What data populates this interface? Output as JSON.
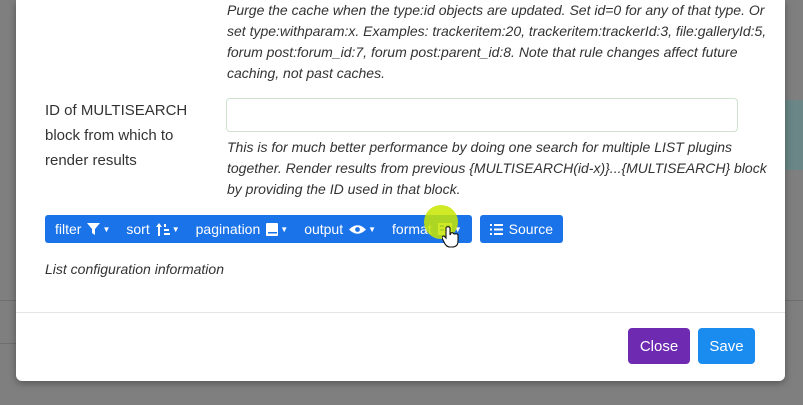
{
  "help_top": "Purge the cache when the type:id objects are updated. Set id=0 for any of that type. Or set type:withparam:x. Examples: trackeritem:20, trackeritem:trackerId:3, file:galleryId:5, forum post:forum_id:7, forum post:parent_id:8. Note that rule changes affect future caching, not past caches.",
  "field": {
    "label": "ID of MULTISEARCH block from which to render results",
    "value": "",
    "placeholder": ""
  },
  "help_bottom": "This is for much better performance by doing one search for multiple LIST plugins together. Render results from previous {MULTISEARCH(id-x)}...{MULTISEARCH} block by providing the ID used in that block.",
  "toolbar": {
    "filter": "filter",
    "sort": "sort",
    "pagination": "pagination",
    "output": "output",
    "format": "format",
    "source": "Source"
  },
  "config_info": "List configuration information",
  "footer": {
    "close": "Close",
    "save": "Save"
  },
  "colors": {
    "toolbar_blue": "#1a73e8",
    "close_purple": "#6f2ab2",
    "save_blue": "#1a8cf0"
  }
}
